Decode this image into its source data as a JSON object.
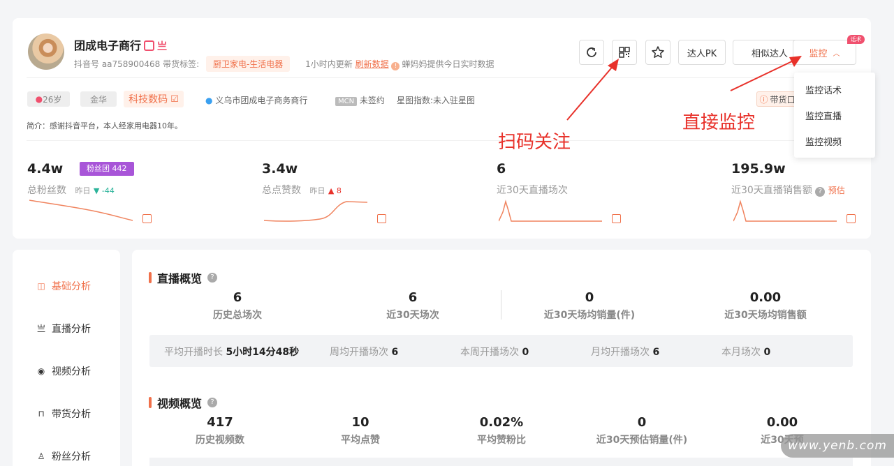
{
  "profile": {
    "name": "团成电子商行",
    "live_icon": "直播",
    "douyin_id": "抖音号 aa758900468",
    "tag_label": "带货标签:",
    "tag": "厨卫家电-生活电器",
    "update_text": "1小时内更新",
    "refresh_link": "刷新数据",
    "provider_text": "蝉妈妈提供今日实时数据",
    "age": "26岁",
    "region": "金华",
    "category": "科技数码",
    "verified": "义乌市团成电子商务商行",
    "mcn_badge": "MCN",
    "mcn_status": "未签约",
    "star_label": "星图指数:",
    "star_value": "未入驻星图",
    "goods_partial": "带货口",
    "bio": "简介：感谢抖音平台，本人经家用电器10年。"
  },
  "actions": {
    "pk": "达人PK",
    "similar": "相似达人",
    "monitor": "监控",
    "new_badge": "话术"
  },
  "monitor_menu": [
    "监控话术",
    "监控直播",
    "监控视频"
  ],
  "stats": [
    {
      "value": "4.4w",
      "label": "总粉丝数",
      "delta_label": "昨日",
      "delta": "▼ -44",
      "badge": "粉丝团 442"
    },
    {
      "value": "3.4w",
      "label": "总点赞数",
      "delta_label": "昨日",
      "delta": "▲ 8"
    },
    {
      "value": "6",
      "label": "近30天直播场次"
    },
    {
      "value": "195.9w",
      "label": "近30天直播销售额",
      "note": "预估"
    }
  ],
  "sidebar": [
    "基础分析",
    "直播分析",
    "视频分析",
    "带货分析",
    "粉丝分析"
  ],
  "live_overview": {
    "title": "直播概览",
    "metrics": [
      {
        "value": "6",
        "label": "历史总场次"
      },
      {
        "value": "6",
        "label": "近30天场次"
      },
      {
        "value": "0",
        "label": "近30天场均销量(件)"
      },
      {
        "value": "0.00",
        "label": "近30天场均销售额"
      }
    ],
    "bar": [
      {
        "label": "平均开播时长",
        "value": "5小时14分48秒"
      },
      {
        "label": "周均开播场次",
        "value": "6"
      },
      {
        "label": "本周开播场次",
        "value": "0"
      },
      {
        "label": "月均开播场次",
        "value": "6"
      },
      {
        "label": "本月场次",
        "value": "0"
      }
    ]
  },
  "video_overview": {
    "title": "视频概览",
    "metrics": [
      {
        "value": "417",
        "label": "历史视频数"
      },
      {
        "value": "10",
        "label": "平均点赞"
      },
      {
        "value": "0.02%",
        "label": "平均赞粉比"
      },
      {
        "value": "0",
        "label": "近30天预估销量(件)"
      },
      {
        "value": "0.00",
        "label": "近30天预"
      }
    ]
  },
  "annotations": {
    "scan": "扫码关注",
    "monitor": "直接监控"
  },
  "watermark": "www.yenb.com",
  "colors": {
    "accent": "#f0704a",
    "red": "#e8312a",
    "purple": "#a855d8",
    "down": "#2bb39a"
  }
}
